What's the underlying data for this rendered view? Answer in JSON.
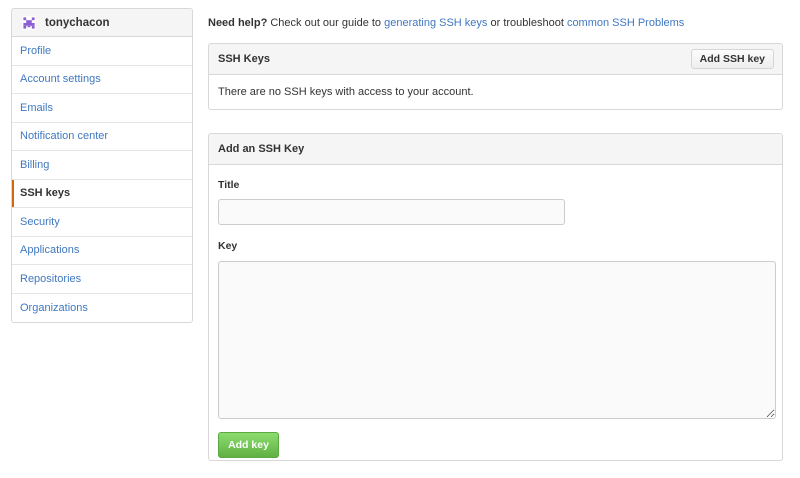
{
  "sidebar": {
    "username": "tonychacon",
    "items": [
      {
        "label": "Profile",
        "selected": false
      },
      {
        "label": "Account settings",
        "selected": false
      },
      {
        "label": "Emails",
        "selected": false
      },
      {
        "label": "Notification center",
        "selected": false
      },
      {
        "label": "Billing",
        "selected": false
      },
      {
        "label": "SSH keys",
        "selected": true
      },
      {
        "label": "Security",
        "selected": false
      },
      {
        "label": "Applications",
        "selected": false
      },
      {
        "label": "Repositories",
        "selected": false
      },
      {
        "label": "Organizations",
        "selected": false
      }
    ]
  },
  "help": {
    "bold": "Need help?",
    "text1": " Check out our guide to ",
    "link1": "generating SSH keys",
    "text2": " or troubleshoot ",
    "link2": "common SSH Problems"
  },
  "ssh_keys_panel": {
    "title": "SSH Keys",
    "add_button_label": "Add SSH key",
    "empty_message": "There are no SSH keys with access to your account."
  },
  "add_key_panel": {
    "title": "Add an SSH Key",
    "title_label": "Title",
    "title_value": "",
    "key_label": "Key",
    "key_value": "",
    "submit_label": "Add key"
  },
  "colors": {
    "link": "#4078c0",
    "selected_indicator": "#d26911",
    "primary_button": "#60b044",
    "avatar": "#8e5fd3"
  },
  "icons": {
    "avatar": "identicon-avatar"
  }
}
